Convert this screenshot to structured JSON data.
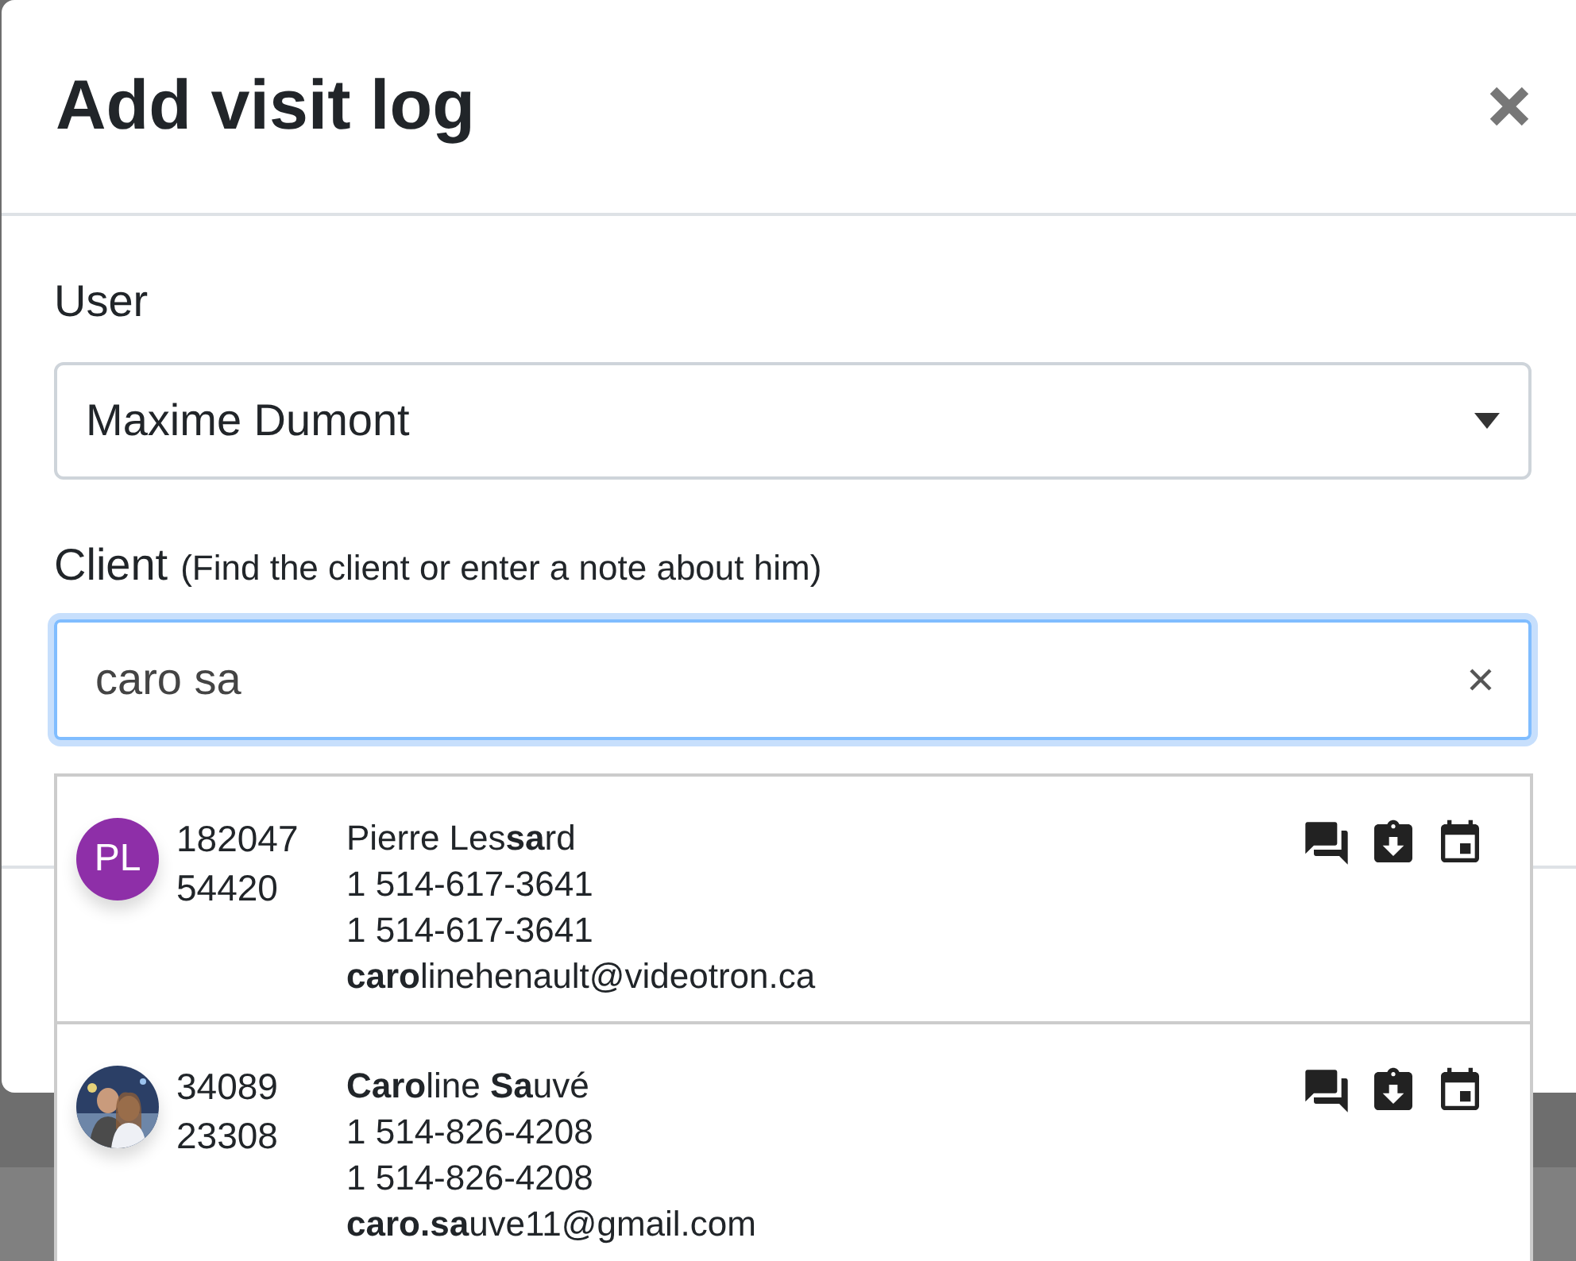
{
  "modal": {
    "title": "Add visit log"
  },
  "user_field": {
    "label": "User",
    "value": "Maxime Dumont"
  },
  "client_field": {
    "label": "Client",
    "hint": "(Find the client or enter a note about him)",
    "value": "caro sa"
  },
  "results": [
    {
      "avatar": {
        "kind": "initials",
        "text": "PL",
        "color": "#8e2fa8"
      },
      "ids": [
        "182047",
        "54420"
      ],
      "lines": [
        "Pierre Les**sa**rd",
        "1 514-617-3641",
        "1 514-617-3641",
        "**caro**linehenault@videotron.ca"
      ]
    },
    {
      "ids": [
        "34089",
        "23308"
      ],
      "lines": [
        "**Caro**line **Sa**uvé",
        "1 514-826-4208",
        "1 514-826-4208",
        "**caro.sa**uve11@gmail.com"
      ]
    }
  ]
}
